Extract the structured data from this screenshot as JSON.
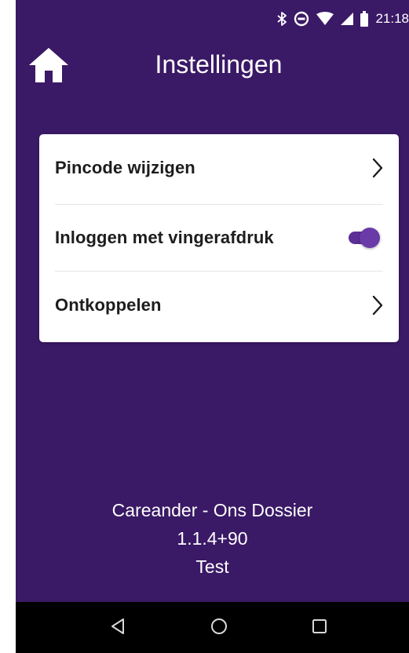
{
  "status_bar": {
    "time": "21:18",
    "icons": [
      "bluetooth-icon",
      "do-not-disturb-icon",
      "wifi-icon",
      "cell-signal-icon",
      "battery-icon"
    ]
  },
  "header": {
    "title": "Instellingen",
    "home_icon": "home-icon"
  },
  "settings": {
    "items": [
      {
        "label": "Pincode wijzigen",
        "control": "chevron-right-icon"
      },
      {
        "label": "Inloggen met vingerafdruk",
        "control": "toggle",
        "enabled": true
      },
      {
        "label": "Ontkoppelen",
        "control": "chevron-right-icon"
      }
    ]
  },
  "app_info": {
    "name": "Careander - Ons Dossier",
    "version": "1.1.4+90",
    "environment": "Test"
  },
  "nav_bar": {
    "buttons": [
      "back-icon",
      "home-circle-icon",
      "recents-icon"
    ]
  },
  "colors": {
    "background": "#3a1966",
    "card": "#ffffff",
    "accent": "#6a3aa8",
    "nav_bar": "#000000"
  }
}
